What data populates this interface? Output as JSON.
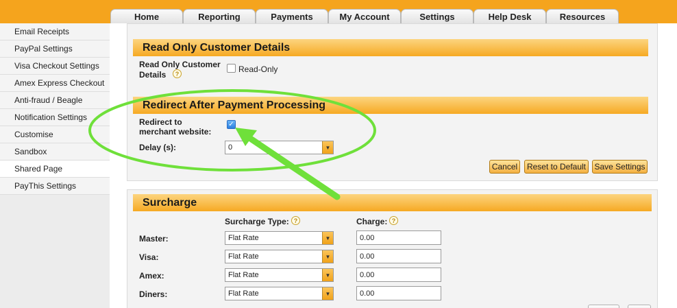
{
  "tabs": [
    {
      "label": "Home"
    },
    {
      "label": "Reporting"
    },
    {
      "label": "Payments"
    },
    {
      "label": "My Account"
    },
    {
      "label": "Settings"
    },
    {
      "label": "Help Desk"
    },
    {
      "label": "Resources"
    }
  ],
  "sidebar": {
    "active": "Shared Page",
    "items": [
      {
        "label": "Email Receipts"
      },
      {
        "label": "PayPal Settings"
      },
      {
        "label": "Visa Checkout Settings"
      },
      {
        "label": "Amex Express Checkout"
      },
      {
        "label": "Anti-fraud / Beagle"
      },
      {
        "label": "Notification Settings"
      },
      {
        "label": "Customise"
      },
      {
        "label": "Sandbox"
      },
      {
        "label": "Shared Page"
      },
      {
        "label": "PayThis Settings"
      }
    ]
  },
  "read_only": {
    "title": "Read Only Customer Details",
    "label_line1": "Read Only Customer",
    "label_line2": "Details",
    "help": "?",
    "checkbox_label": "Read-Only",
    "checked": false
  },
  "redirect": {
    "title": "Redirect After Payment Processing",
    "label_line1": "Redirect to",
    "label_line2": "merchant website:",
    "checked": true,
    "check_glyph": "✓",
    "delay_label": "Delay (s):",
    "delay_value": "0",
    "arrow_glyph": "▼"
  },
  "actions": {
    "cancel": "Cancel",
    "reset": "Reset to Default",
    "save": "Save Settings"
  },
  "surcharge": {
    "title": "Surcharge",
    "type_header": "Surcharge Type:",
    "charge_header": "Charge:",
    "help": "?",
    "rows": [
      {
        "card": "Master:",
        "type": "Flat Rate",
        "charge": "0.00"
      },
      {
        "card": "Visa:",
        "type": "Flat Rate",
        "charge": "0.00"
      },
      {
        "card": "Amex:",
        "type": "Flat Rate",
        "charge": "0.00"
      },
      {
        "card": "Diners:",
        "type": "Flat Rate",
        "charge": "0.00"
      }
    ]
  },
  "annotation": {
    "highlight_color": "#6fe03a"
  }
}
